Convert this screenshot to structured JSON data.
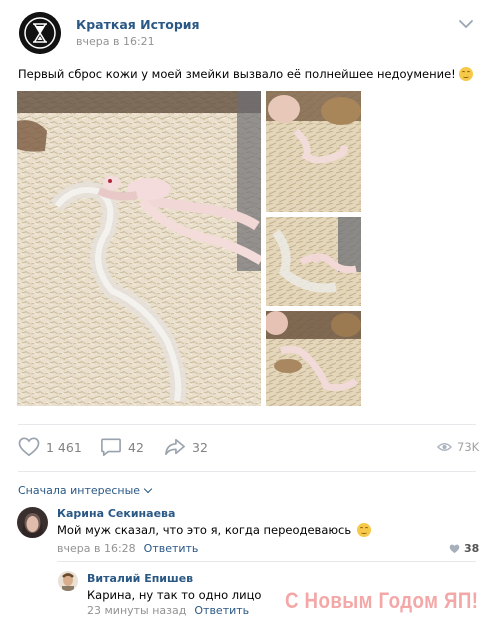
{
  "post": {
    "group_name": "Краткая История",
    "time": "вчера в 16:21",
    "text": "Первый сброс кожи у моей змейки вызвало её полнейшее недоумение!",
    "emoji": "smiling-face-emoji"
  },
  "photos": [
    {
      "name": "photo-main"
    },
    {
      "name": "photo-thumb-1"
    },
    {
      "name": "photo-thumb-2"
    },
    {
      "name": "photo-thumb-3"
    }
  ],
  "actions": {
    "likes": "1 461",
    "comments": "42",
    "shares": "32",
    "views": "73K"
  },
  "comments_section": {
    "sort_label": "Сначала интересные",
    "items": [
      {
        "author": "Карина Секинаева",
        "text": "Мой муж сказал, что это я, когда переодеваюсь",
        "emoji": "laughing-tears-emoji",
        "time": "вчера в 16:28",
        "reply_label": "Ответить",
        "likes": "38"
      },
      {
        "author": "Виталий Епишев",
        "text": "Карина, ну так то одно лицо",
        "time": "23 минуты назад",
        "reply_label": "Ответить"
      }
    ]
  },
  "watermark": "С Новым Годом ЯП!",
  "colors": {
    "link": "#2a5885",
    "meta": "#939393",
    "divider": "#e7e8ec",
    "action": "#828282"
  }
}
